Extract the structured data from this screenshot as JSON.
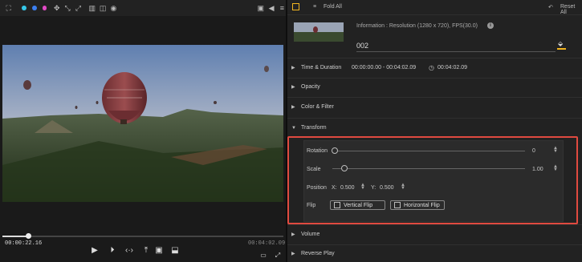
{
  "colors": {
    "accent": "#f2b51f",
    "highlight_border": "#e04a40",
    "panel_bg": "#222222"
  },
  "preview": {
    "toolbar_icons": [
      "crop-icon",
      "color-dot-cyan",
      "color-dot-blue",
      "color-dot-pink",
      "move-icon",
      "transform-icon",
      "transform2-icon",
      "lock-icon",
      "split-icon",
      "eye-icon",
      "camera-icon",
      "volume-icon",
      "menu-icon"
    ],
    "current_time": "00:00:22.16",
    "total_time": "00:04:02.09",
    "progress_fraction": 0.09
  },
  "panel": {
    "fold_all": "Fold All",
    "reset_all": "Reset All",
    "info": "Information : Resolution (1280 x 720), FPS(30.0)",
    "clip_name": "002",
    "sections": {
      "time_duration": "Time & Duration",
      "time_range": "00:00:00.00 - 00:04:02.09",
      "duration": "00:04:02.09",
      "opacity": "Opacity",
      "color_filter": "Color & Filter",
      "transform": "Transform",
      "volume": "Volume",
      "reverse_play": "Reverse Play"
    },
    "transform": {
      "rotation_label": "Rotation",
      "rotation_value": "0",
      "rotation_fraction": 0.0,
      "scale_label": "Scale",
      "scale_value": "1.00",
      "scale_fraction": 0.06,
      "position_label": "Position",
      "x_label": "X:",
      "x_value": "0.500",
      "y_label": "Y:",
      "y_value": "0.500",
      "flip_label": "Flip",
      "vertical_flip": "Vertical Flip",
      "horizontal_flip": "Horizontal Flip"
    }
  }
}
